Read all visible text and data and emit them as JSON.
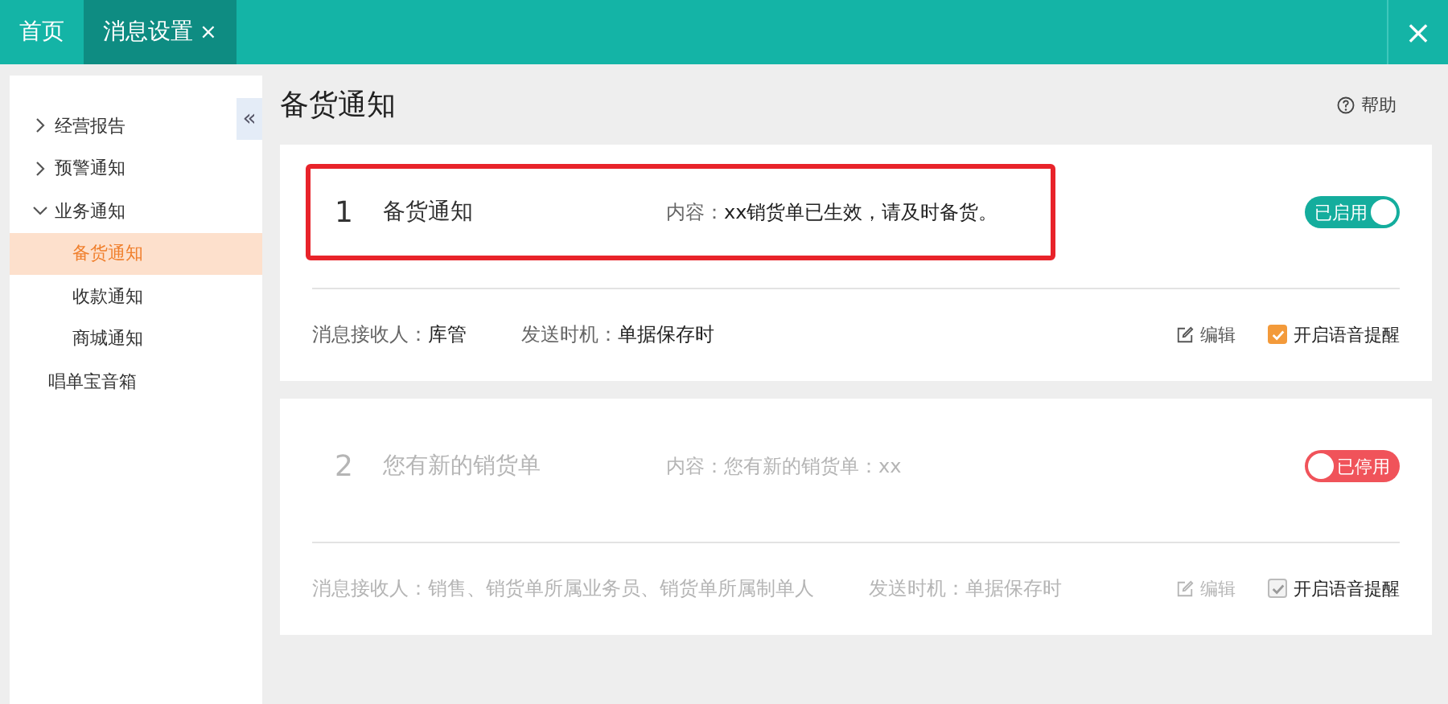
{
  "tabs": [
    {
      "label": "首页",
      "selected": false
    },
    {
      "label": "消息设置",
      "selected": true,
      "close": "×"
    }
  ],
  "window_close": "×",
  "sidebar": {
    "collapse": "«",
    "items": [
      {
        "label": "经营报告",
        "expanded": false,
        "selected": false
      },
      {
        "label": "预警通知",
        "expanded": false,
        "selected": false
      },
      {
        "label": "业务通知",
        "expanded": true,
        "selected": false,
        "children": [
          {
            "label": "备货通知",
            "selected": true
          },
          {
            "label": "收款通知",
            "selected": false
          },
          {
            "label": "商城通知",
            "selected": false
          }
        ]
      },
      {
        "label": "唱单宝音箱",
        "selected": false
      }
    ]
  },
  "page": {
    "title": "备货通知",
    "help": "帮助"
  },
  "notices": [
    {
      "index": "1",
      "name": "备货通知",
      "content_label": "内容：",
      "content": "xx销货单已生效，请及时备货。",
      "highlighted": true,
      "enabled": true,
      "toggle_label": "已启用",
      "recipient_label": "消息接收人：",
      "recipient": "库管",
      "timing_label": "发送时机：",
      "timing": "单据保存时",
      "edit": "编辑",
      "voice_checked": true,
      "voice_label": "开启语音提醒"
    },
    {
      "index": "2",
      "name": "您有新的销货单",
      "content_label": "内容：",
      "content": "您有新的销货单：xx",
      "highlighted": false,
      "enabled": false,
      "toggle_label": "已停用",
      "recipient_label": "消息接收人：",
      "recipient": "销售、销货单所属业务员、销货单所属制单人",
      "timing_label": "发送时机：",
      "timing": "单据保存时",
      "edit": "编辑",
      "voice_checked": true,
      "voice_label": "开启语音提醒"
    }
  ]
}
